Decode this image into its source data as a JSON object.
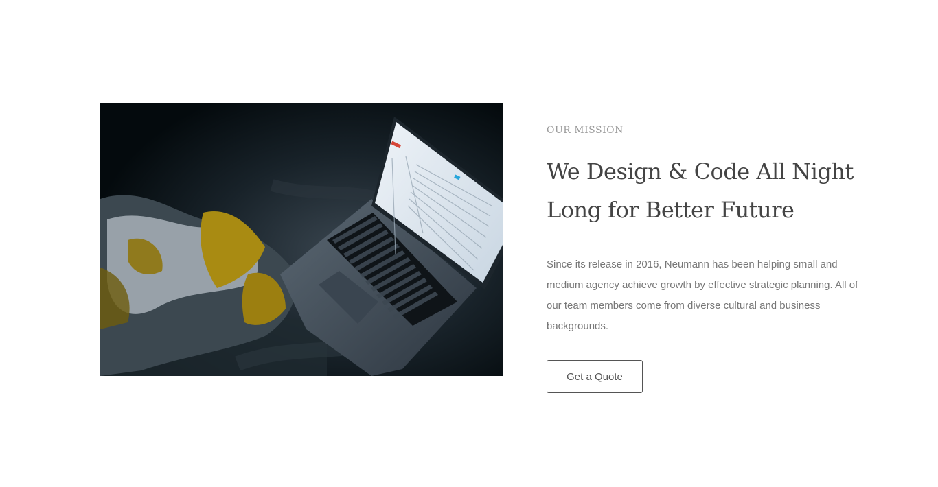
{
  "mission": {
    "eyebrow": "OUR MISSION",
    "heading_line1": "We Design & Code All Night",
    "heading_line2": "Long for Better Future",
    "description": "Since its release in 2016, Neumann has been helping small and medium agency achieve growth by effective strategic planning. All of our team members come from diverse cultural and business backgrounds.",
    "cta_label": "Get a Quote"
  }
}
